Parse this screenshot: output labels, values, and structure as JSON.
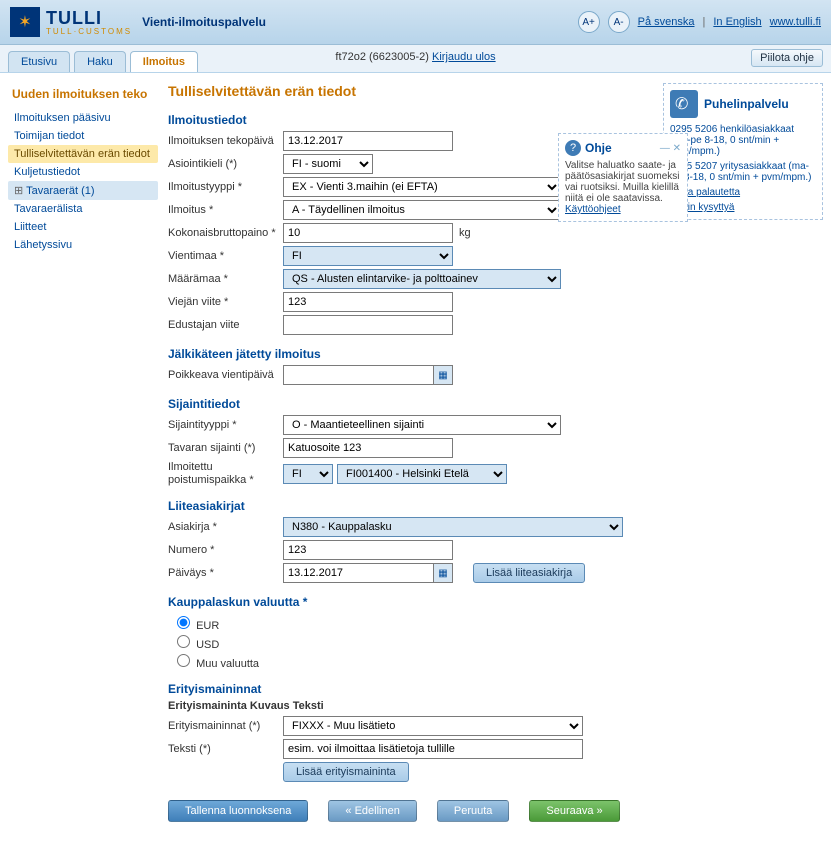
{
  "header": {
    "logo_main": "TULLI",
    "logo_sub": "TULL·CUSTOMS",
    "service": "Vienti-ilmoituspalvelu",
    "font_minus": "A-",
    "font_plus": "A+",
    "lang_sv": "På svenska",
    "lang_en": "In English",
    "site": "www.tulli.fi"
  },
  "tabs": {
    "t0": "Etusivu",
    "t1": "Haku",
    "t2": "Ilmoitus",
    "session_id": "ft72o2 (6623005-2)",
    "logout": "Kirjaudu ulos",
    "hide_help": "Piilota ohje"
  },
  "sidebar": {
    "title": "Uuden ilmoituksen teko",
    "items": {
      "i0": "Ilmoituksen pääsivu",
      "i1": "Toimijan tiedot",
      "i2": "Tulliselvitettävän erän tiedot",
      "i3": "Kuljetustiedot",
      "i4": "Tavaraerät (1)",
      "i5": "Tavaraerälista",
      "i6": "Liitteet",
      "i7": "Lähetyssivu"
    }
  },
  "main": {
    "title": "Tulliselvitettävän erän tiedot",
    "g_ilmo": "Ilmoitustiedot",
    "l_date": "Ilmoituksen tekopäivä",
    "v_date": "13.12.2017",
    "l_lang": "Asiointikieli (*)",
    "v_lang": "FI - suomi",
    "l_type": "Ilmoitustyyppi *",
    "v_type": "EX - Vienti 3.maihin (ei EFTA)",
    "l_ilm": "Ilmoitus *",
    "v_ilm": "A - Täydellinen ilmoitus",
    "l_weight": "Kokonaisbruttopaino *",
    "v_weight": "10",
    "u_weight": "kg",
    "l_expcountry": "Vientimaa *",
    "v_expcountry": "FI",
    "l_destcountry": "Määrämaa *",
    "v_destcountry": "QS - Alusten elintarvike- ja polttoainev",
    "l_expref": "Viejän viite *",
    "v_expref": "123",
    "l_agentref": "Edustajan viite",
    "v_agentref": "",
    "g_late": "Jälkikäteen jätetty ilmoitus",
    "l_devdate": "Poikkeava vientipäivä",
    "v_devdate": "",
    "g_loc": "Sijaintitiedot",
    "l_loctype": "Sijaintityyppi *",
    "v_loctype": "O - Maantieteellinen sijainti",
    "l_goodsloc": "Tavaran sijainti (*)",
    "v_goodsloc": "Katuosoite 123",
    "l_exit": "Ilmoitettu poistumispaikka *",
    "v_exit_c": "FI",
    "v_exit_off": "FI001400 - Helsinki Etelä",
    "g_docs": "Liiteasiakirjat",
    "l_doc": "Asiakirja *",
    "v_doc": "N380 - Kauppalasku",
    "l_num": "Numero *",
    "v_num": "123",
    "l_ddate": "Päiväys *",
    "v_ddate": "13.12.2017",
    "btn_adddoc": "Lisää liiteasiakirja",
    "g_curr": "Kauppalaskun valuutta *",
    "c_eur": "EUR",
    "c_usd": "USD",
    "c_other": "Muu valuutta",
    "g_special": "Erityismaininnat",
    "sub_special": "Erityismaininta Kuvaus Teksti",
    "l_sp": "Erityismaininnat (*)",
    "v_sp": "FIXXX - Muu lisätieto",
    "l_txt": "Teksti (*)",
    "v_txt": "esim. voi ilmoittaa lisätietoja tullille",
    "btn_addsp": "Lisää erityismaininta"
  },
  "actions": {
    "draft": "Tallenna luonnoksena",
    "prev": "«  Edellinen",
    "cancel": "Peruuta",
    "next": "Seuraava  »"
  },
  "phone": {
    "title": "Puhelinpalvelu",
    "l1": "0295 5206 henkilöasiakkaat (ma-pe 8-18, 0 snt/min + pvm/mpm.)",
    "l2": "0295 5207 yritysasiakkaat (ma-pe 8-18, 0 snt/min + pvm/mpm.)",
    "a1": "Anna palautetta",
    "a2": "Usein kysyttyä"
  },
  "ohje": {
    "title": "Ohje",
    "body": "Valitse haluatko saate- ja päätösasiakirjat suomeksi vai ruotsiksi. Muilla kielillä niitä ei ole saatavissa.",
    "link": "Käyttöohjeet",
    "min": "— ✕"
  }
}
